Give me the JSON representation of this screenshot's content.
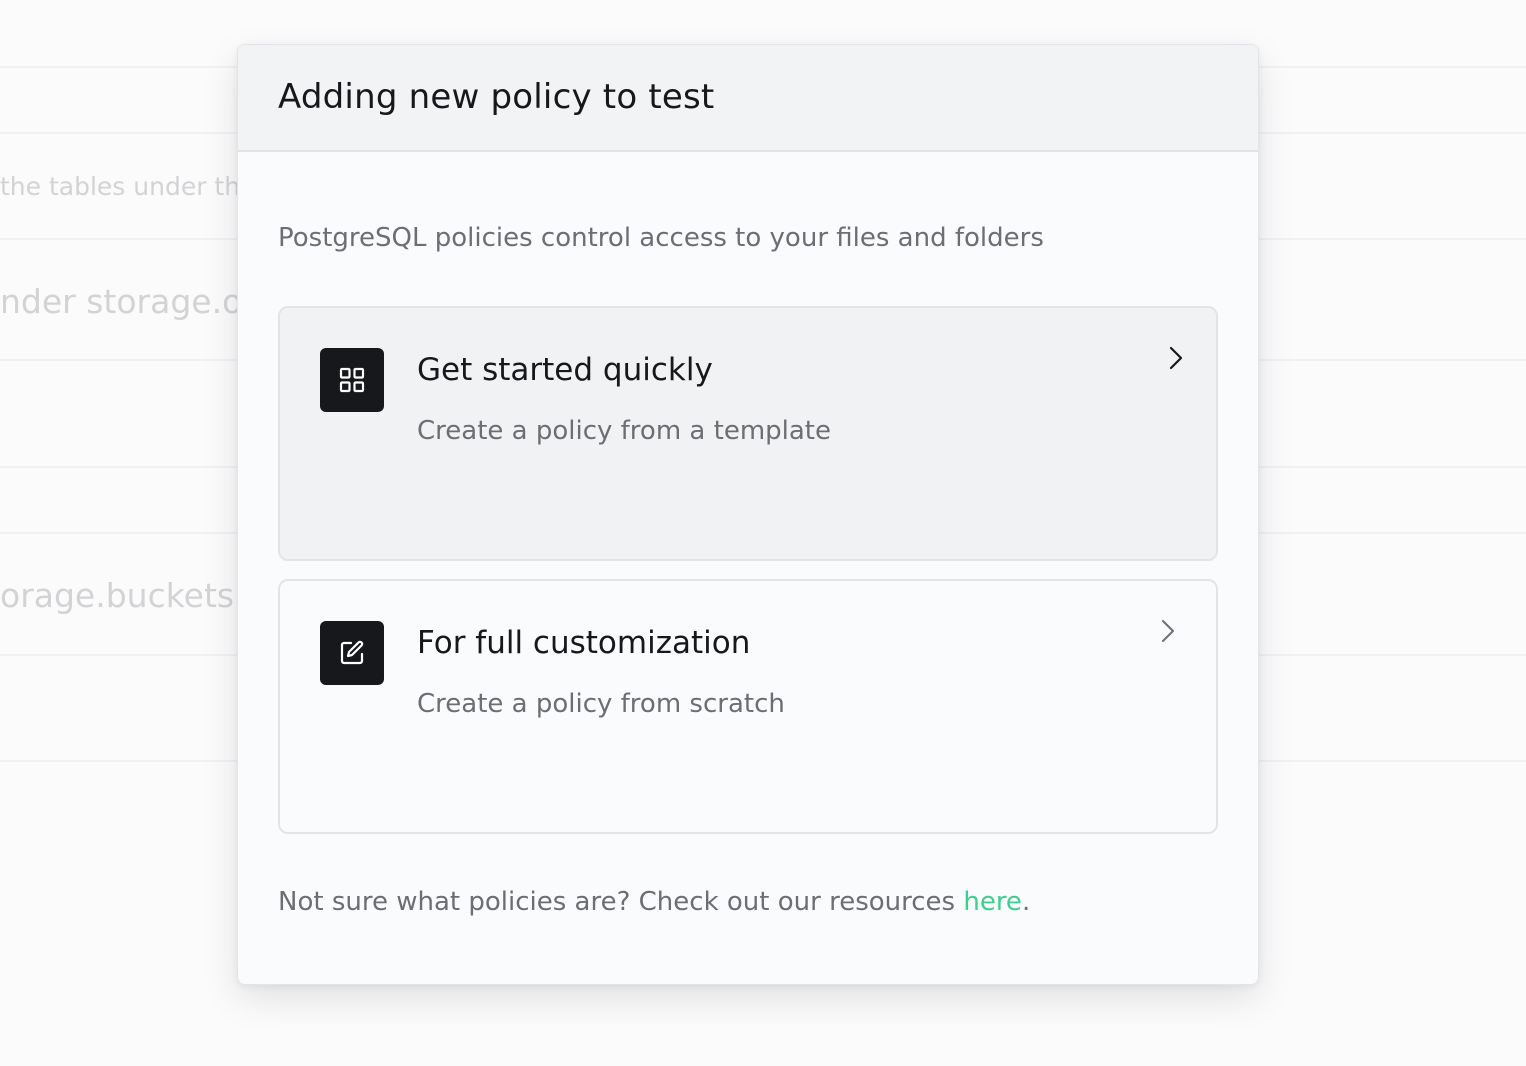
{
  "background": {
    "row_texts": [
      "the tables under th",
      "nder storage.ob",
      "orage.buckets"
    ]
  },
  "modal": {
    "title": "Adding new policy to test",
    "intro": "PostgreSQL policies control access to your files and folders",
    "options": [
      {
        "title": "Get started quickly",
        "description": "Create a policy from a template",
        "icon": "grid-icon",
        "chevron": "chevron-right-icon",
        "hovered": true
      },
      {
        "title": "For full customization",
        "description": "Create a policy from scratch",
        "icon": "edit-icon",
        "chevron": "chevron-right-icon",
        "hovered": false
      }
    ],
    "footer": {
      "text": "Not sure what policies are? Check out our resources ",
      "link_label": "here",
      "suffix": "."
    }
  },
  "colors": {
    "accent_link": "#3ecf8e",
    "icon_tile": "#16181b",
    "header_bg": "#f2f3f5"
  }
}
